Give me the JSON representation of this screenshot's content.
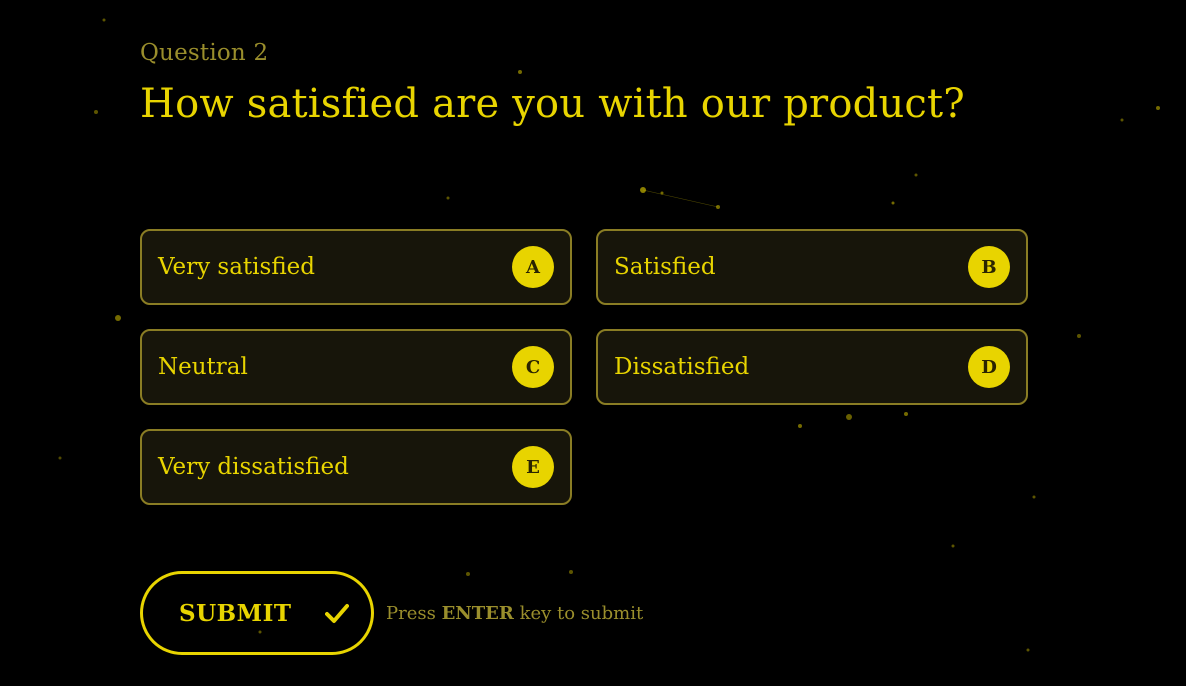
{
  "question": {
    "number_label": "Question 2",
    "title": "How satisfied are you with our product?"
  },
  "options": [
    {
      "label": "Very satisfied",
      "key": "A"
    },
    {
      "label": "Satisfied",
      "key": "B"
    },
    {
      "label": "Neutral",
      "key": "C"
    },
    {
      "label": "Dissatisfied",
      "key": "D"
    },
    {
      "label": "Very dissatisfied",
      "key": "E"
    }
  ],
  "submit": {
    "label": "SUBMIT",
    "icon": "check-icon",
    "hint_prefix": "Press",
    "hint_key": "ENTER",
    "hint_suffix": "key to submit"
  },
  "colors": {
    "background": "#000000",
    "accent": "#e8d400",
    "muted": "#9a8e2c",
    "option_bg": "#17150a",
    "option_border": "#8a7d24"
  }
}
